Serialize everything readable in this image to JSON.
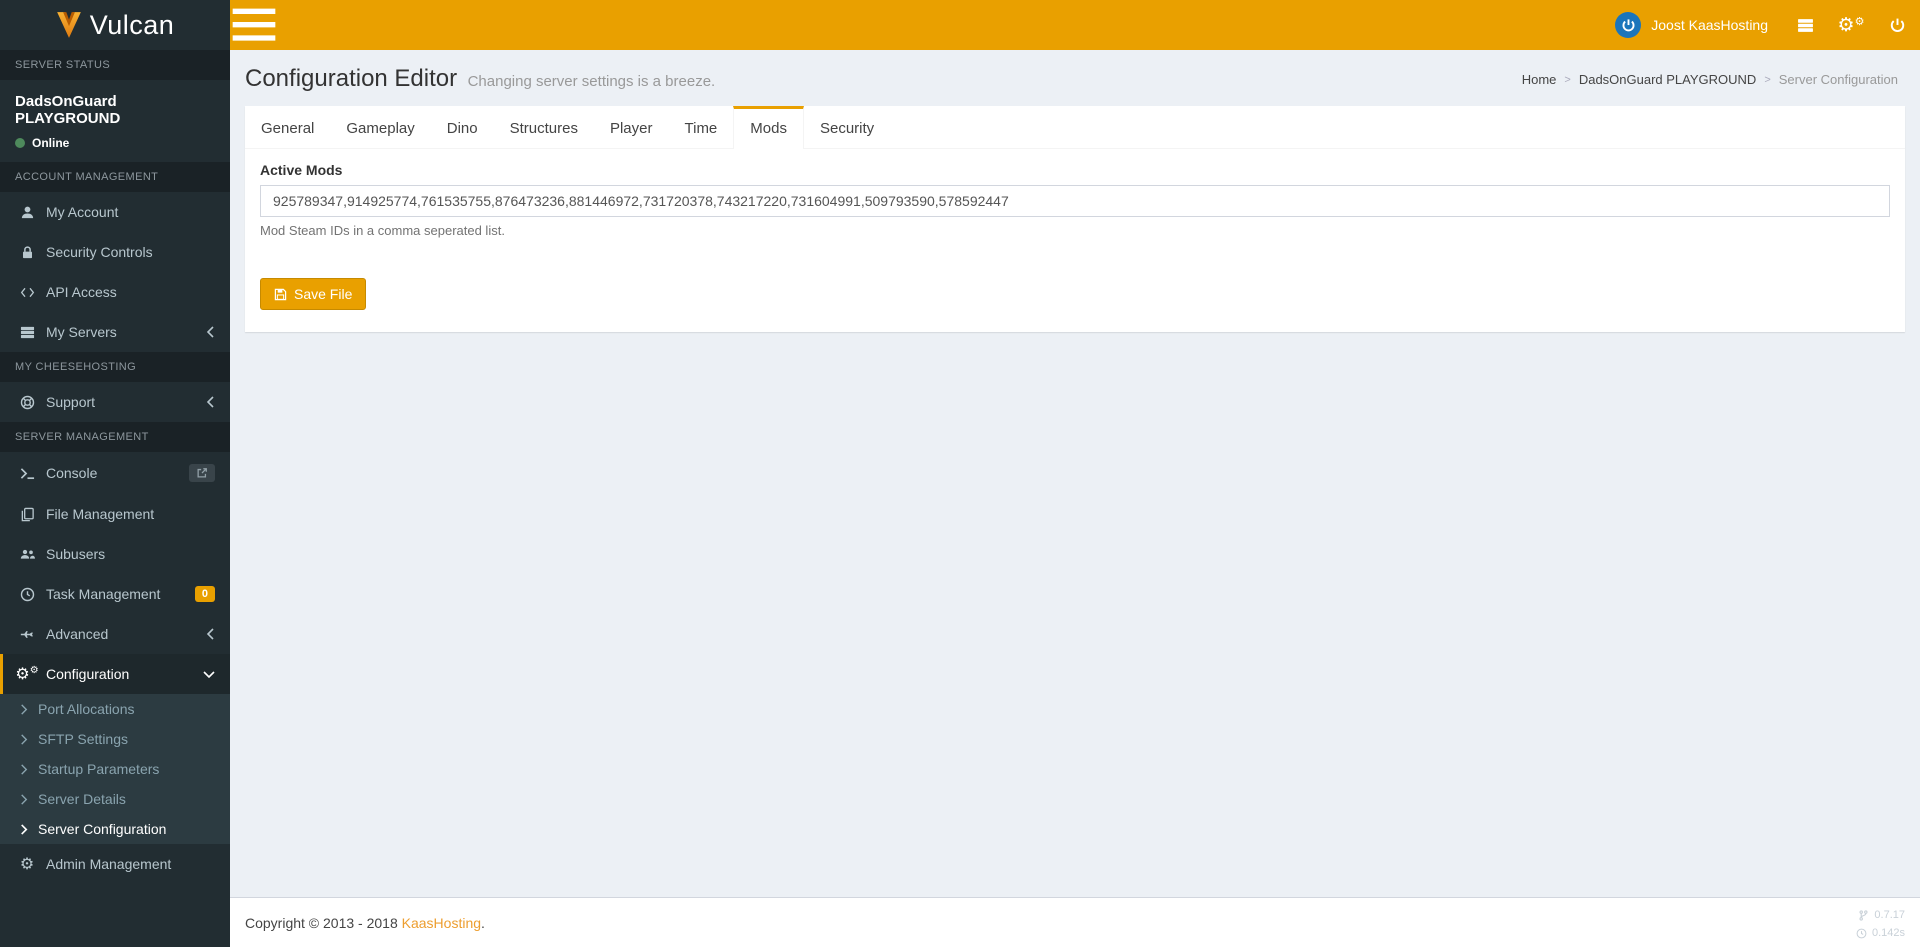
{
  "app": {
    "logo_text": "Vulcan"
  },
  "navbar": {
    "user_name": "Joost KaasHosting",
    "icons": [
      "hamburger-icon",
      "kaashosting-logo-avatar",
      "server-list-icon",
      "cogs-icon",
      "power-icon"
    ]
  },
  "sidebar": {
    "server_status_header": "SERVER STATUS",
    "server_name": "DadsOnGuard PLAYGROUND",
    "server_state": "Online",
    "account_header": "ACCOUNT MANAGEMENT",
    "my_account": "My Account",
    "security_controls": "Security Controls",
    "api_access": "API Access",
    "my_servers": "My Servers",
    "cheesehosting_header": "MY CHEESEHOSTING",
    "support": "Support",
    "server_management_header": "SERVER MANAGEMENT",
    "console": "Console",
    "file_management": "File Management",
    "subusers": "Subusers",
    "task_management": "Task Management",
    "task_badge": "0",
    "advanced": "Advanced",
    "configuration": "Configuration",
    "port_allocations": "Port Allocations",
    "sftp_settings": "SFTP Settings",
    "startup_parameters": "Startup Parameters",
    "server_details": "Server Details",
    "server_configuration": "Server Configuration",
    "admin_management": "Admin Management",
    "icons": [
      "user-icon",
      "lock-icon",
      "code-icon",
      "server-icon",
      "life-ring-icon",
      "terminal-icon",
      "external-link-icon",
      "copy-icon",
      "users-icon",
      "clock-icon",
      "fighter-jet-icon",
      "cogs-icon",
      "gear-icon",
      "angle-left-icon",
      "angle-down-icon",
      "angle-right-icon"
    ]
  },
  "page": {
    "title": "Configuration Editor",
    "subtitle": "Changing server settings is a breeze."
  },
  "breadcrumb": {
    "home": "Home",
    "server": "DadsOnGuard PLAYGROUND",
    "current": "Server Configuration",
    "separator": ">"
  },
  "tabs": {
    "general": "General",
    "gameplay": "Gameplay",
    "dino": "Dino",
    "structures": "Structures",
    "player": "Player",
    "time": "Time",
    "mods": "Mods",
    "security": "Security"
  },
  "form": {
    "active_mods_label": "Active Mods",
    "active_mods_value": "925789347,914925774,761535755,876473236,881446972,731720378,743217220,731604991,509793590,578592447",
    "active_mods_help": "Mod Steam IDs in a comma seperated list.",
    "save_button": "Save File"
  },
  "footer": {
    "copyright": "Copyright © 2013 - 2018",
    "brand": "KaasHosting",
    "period": ".",
    "version": "0.7.17",
    "render_time": "0.142s"
  },
  "colors": {
    "accent": "#e9a000",
    "sidebar_bg": "#222d32",
    "sidebar_header_bg": "#1a2226",
    "submenu_bg": "#2c3b41",
    "content_bg": "#ecf0f5",
    "online_green": "#4e8a5c",
    "avatar_blue": "#1b75bb"
  }
}
